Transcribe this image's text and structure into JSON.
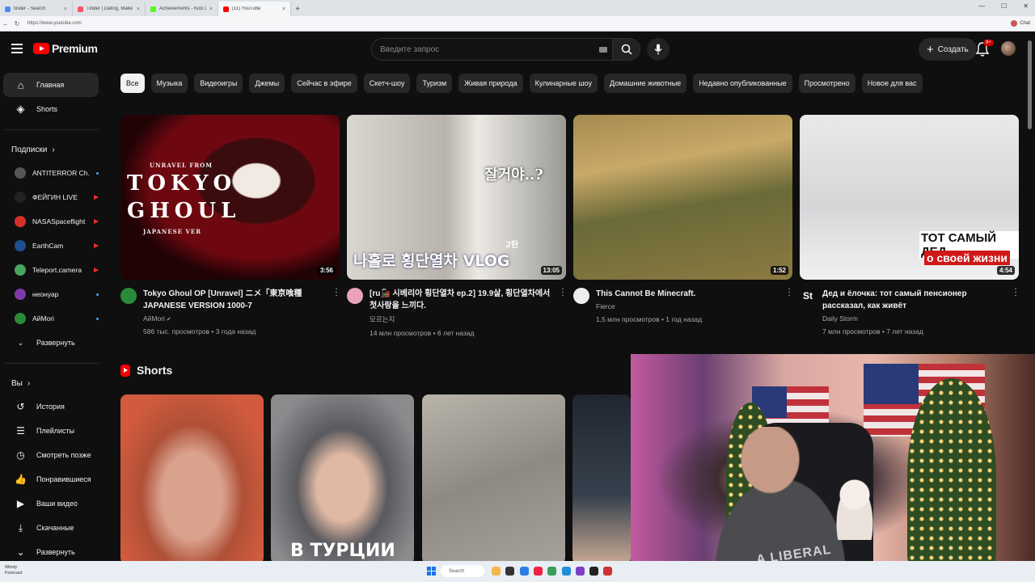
{
  "browser": {
    "tabs": [
      {
        "label": "tinder - Search",
        "color": "#4c8bf5",
        "active": false
      },
      {
        "label": "Tinder | Dating, Make Friends & M",
        "color": "#fd5068",
        "active": false
      },
      {
        "label": "Achievements - Kick Dashboard",
        "color": "#53fc18",
        "active": false
      },
      {
        "label": "(11) YouTube",
        "color": "#ff0000",
        "active": true
      }
    ],
    "url": "https://www.youtube.com",
    "profile_label": "Chat"
  },
  "header": {
    "brand": "Premium",
    "search_placeholder": "Введите запрос",
    "create_label": "Создать",
    "notifications_badge": "9+"
  },
  "sidebar": {
    "main": [
      {
        "label": "Главная",
        "icon": "home-icon",
        "active": true
      },
      {
        "label": "Shorts",
        "icon": "shorts-icon",
        "active": false
      }
    ],
    "subscriptions_heading": "Подписки",
    "subscriptions": [
      {
        "name": "ANTITERROR Ch...",
        "color": "#555555",
        "status": "blue"
      },
      {
        "name": "ФЕЙГИН LIVE",
        "color": "#222222",
        "status": "red"
      },
      {
        "name": "NASASpaceflight",
        "color": "#d6302a",
        "status": "red"
      },
      {
        "name": "EarthCam",
        "color": "#1f4f8f",
        "status": "red"
      },
      {
        "name": "Teleport.camera",
        "color": "#48a55c",
        "status": "red"
      },
      {
        "name": "неонуар",
        "color": "#7d3ba8",
        "status": "blue"
      },
      {
        "name": "АйМori",
        "color": "#2a8a3a",
        "status": "blue"
      }
    ],
    "expand_label": "Развернуть",
    "you_heading": "Вы",
    "you_items": [
      {
        "label": "История",
        "icon": "history-icon"
      },
      {
        "label": "Плейлисты",
        "icon": "playlists-icon"
      },
      {
        "label": "Смотреть позже",
        "icon": "watch-later-icon"
      },
      {
        "label": "Понравившиеся",
        "icon": "like-icon"
      },
      {
        "label": "Ваши видео",
        "icon": "your-videos-icon"
      },
      {
        "label": "Скачанные",
        "icon": "download-icon"
      },
      {
        "label": "Развернуть",
        "icon": "chevron-down-icon"
      }
    ]
  },
  "chips": [
    "Все",
    "Музыка",
    "Видеоигры",
    "Джемы",
    "Сейчас в эфире",
    "Скетч-шоу",
    "Туризм",
    "Живая природа",
    "Кулинарные шоу",
    "Домашние животные",
    "Недавно опубликованные",
    "Просмотрено",
    "Новое для вас"
  ],
  "videos": [
    {
      "title": "Tokyo Ghoul OP [Unravel] ニメ「東京喰種 JAPANESE VERSION 1000-7",
      "channel": "АйМori",
      "verified": true,
      "stats": "586 тыс. просмотров • 3 года назад",
      "duration": "3:56",
      "avatar_color": "#2a8a3a",
      "thumb_text": [
        "UNRAVEL FROM",
        "TOKYO",
        "GHOUL",
        "JAPANESE VER"
      ]
    },
    {
      "title": "[ru🚂 시베리아 횡단열차 ep.2] 19.9살, 횡단열차에서 첫사랑을 느끼다.",
      "channel": "모르는지",
      "verified": false,
      "stats": "14 млн просмотров • 6 лет назад",
      "duration": "13:05",
      "avatar_color": "#e8a3b8",
      "thumb_text": [
        "잘거야..?",
        "나홀로 횡단열차 VLOG",
        "2탄"
      ]
    },
    {
      "title": "This Cannot Be Minecraft.",
      "channel": "Fierce",
      "verified": false,
      "stats": "1,5 млн просмотров • 1 год назад",
      "duration": "1:52",
      "avatar_color": "#eeeeee",
      "thumb_text": []
    },
    {
      "title": "Дед и ёлочка: тот самый пенсионер рассказал, как живёт",
      "channel": "Daily Storm",
      "verified": false,
      "stats": "7 млн просмотров • 7 лет назад",
      "duration": "4:54",
      "avatar_color": "#0f0f0f",
      "avatar_text": "St",
      "thumb_text": [
        "ТОТ САМЫЙ ДЕД",
        "о своей жизни"
      ]
    }
  ],
  "shorts": {
    "heading": "Shorts",
    "items": [
      {
        "text": ""
      },
      {
        "text": "В ТУРЦИИ"
      },
      {
        "text": ""
      },
      {
        "text": ""
      }
    ]
  },
  "webcam": {
    "shirt_text": "A LIBERAL"
  },
  "taskbar": {
    "weather_line1": "Windy",
    "weather_line2": "Forecast",
    "search_label": "Search"
  }
}
